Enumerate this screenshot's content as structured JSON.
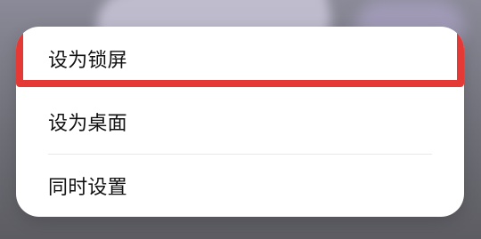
{
  "dialog": {
    "options": [
      {
        "label": "设为锁屏"
      },
      {
        "label": "设为桌面"
      },
      {
        "label": "同时设置"
      }
    ]
  },
  "theme": {
    "highlight_color": "#e53935",
    "menu_background": "#ffffff"
  }
}
